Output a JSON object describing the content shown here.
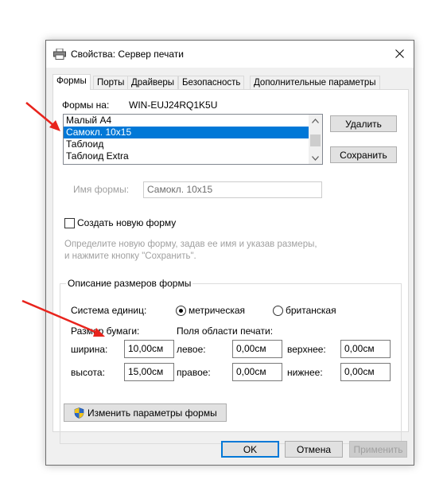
{
  "window": {
    "title": "Свойства: Сервер печати",
    "close_icon": "close-icon",
    "printer_icon": "printer-icon"
  },
  "tabs": [
    {
      "label": "Формы",
      "active": true
    },
    {
      "label": "Порты",
      "active": false
    },
    {
      "label": "Драйверы",
      "active": false
    },
    {
      "label": "Безопасность",
      "active": false
    },
    {
      "label": "Дополнительные параметры",
      "active": false
    }
  ],
  "forms": {
    "forms_on_label": "Формы на:",
    "server_name": "WIN-EUJ24RQ1K5U",
    "list": [
      {
        "label": "Малый A4",
        "selected": false
      },
      {
        "label": "Самокл. 10x15",
        "selected": true
      },
      {
        "label": "Таблоид",
        "selected": false
      },
      {
        "label": "Таблоид Extra",
        "selected": false
      }
    ],
    "delete_button": "Удалить",
    "save_button": "Сохранить",
    "form_name_label": "Имя формы:",
    "form_name_value": "Самокл. 10x15",
    "create_new_label": "Создать новую форму",
    "create_new_checked": false,
    "hint_line1": "Определите новую форму, задав ее имя и указав размеры,",
    "hint_line2": "и нажмите кнопку \"Сохранить\"."
  },
  "size_group": {
    "title": "Описание размеров формы",
    "units_label": "Система единиц:",
    "unit_metric": "метрическая",
    "unit_british": "британская",
    "selected_unit": "metric",
    "paper_size_label": "Размер бумаги:",
    "print_area_label": "Поля области печати:",
    "width_label": "ширина:",
    "width_value": "10,00см",
    "height_label": "высота:",
    "height_value": "15,00см",
    "left_label": "левое:",
    "left_value": "0,00см",
    "right_label": "правое:",
    "right_value": "0,00см",
    "top_label": "верхнее:",
    "top_value": "0,00см",
    "bottom_label": "нижнее:",
    "bottom_value": "0,00см",
    "change_params_button": "Изменить параметры формы",
    "shield_icon": "shield-icon"
  },
  "footer": {
    "ok_button": "OK",
    "cancel_button": "Отмена",
    "apply_button": "Применить"
  },
  "colors": {
    "selection": "#0078d7",
    "annotation_arrow": "#e8231c",
    "dialog_bg": "#f0f0f0"
  }
}
